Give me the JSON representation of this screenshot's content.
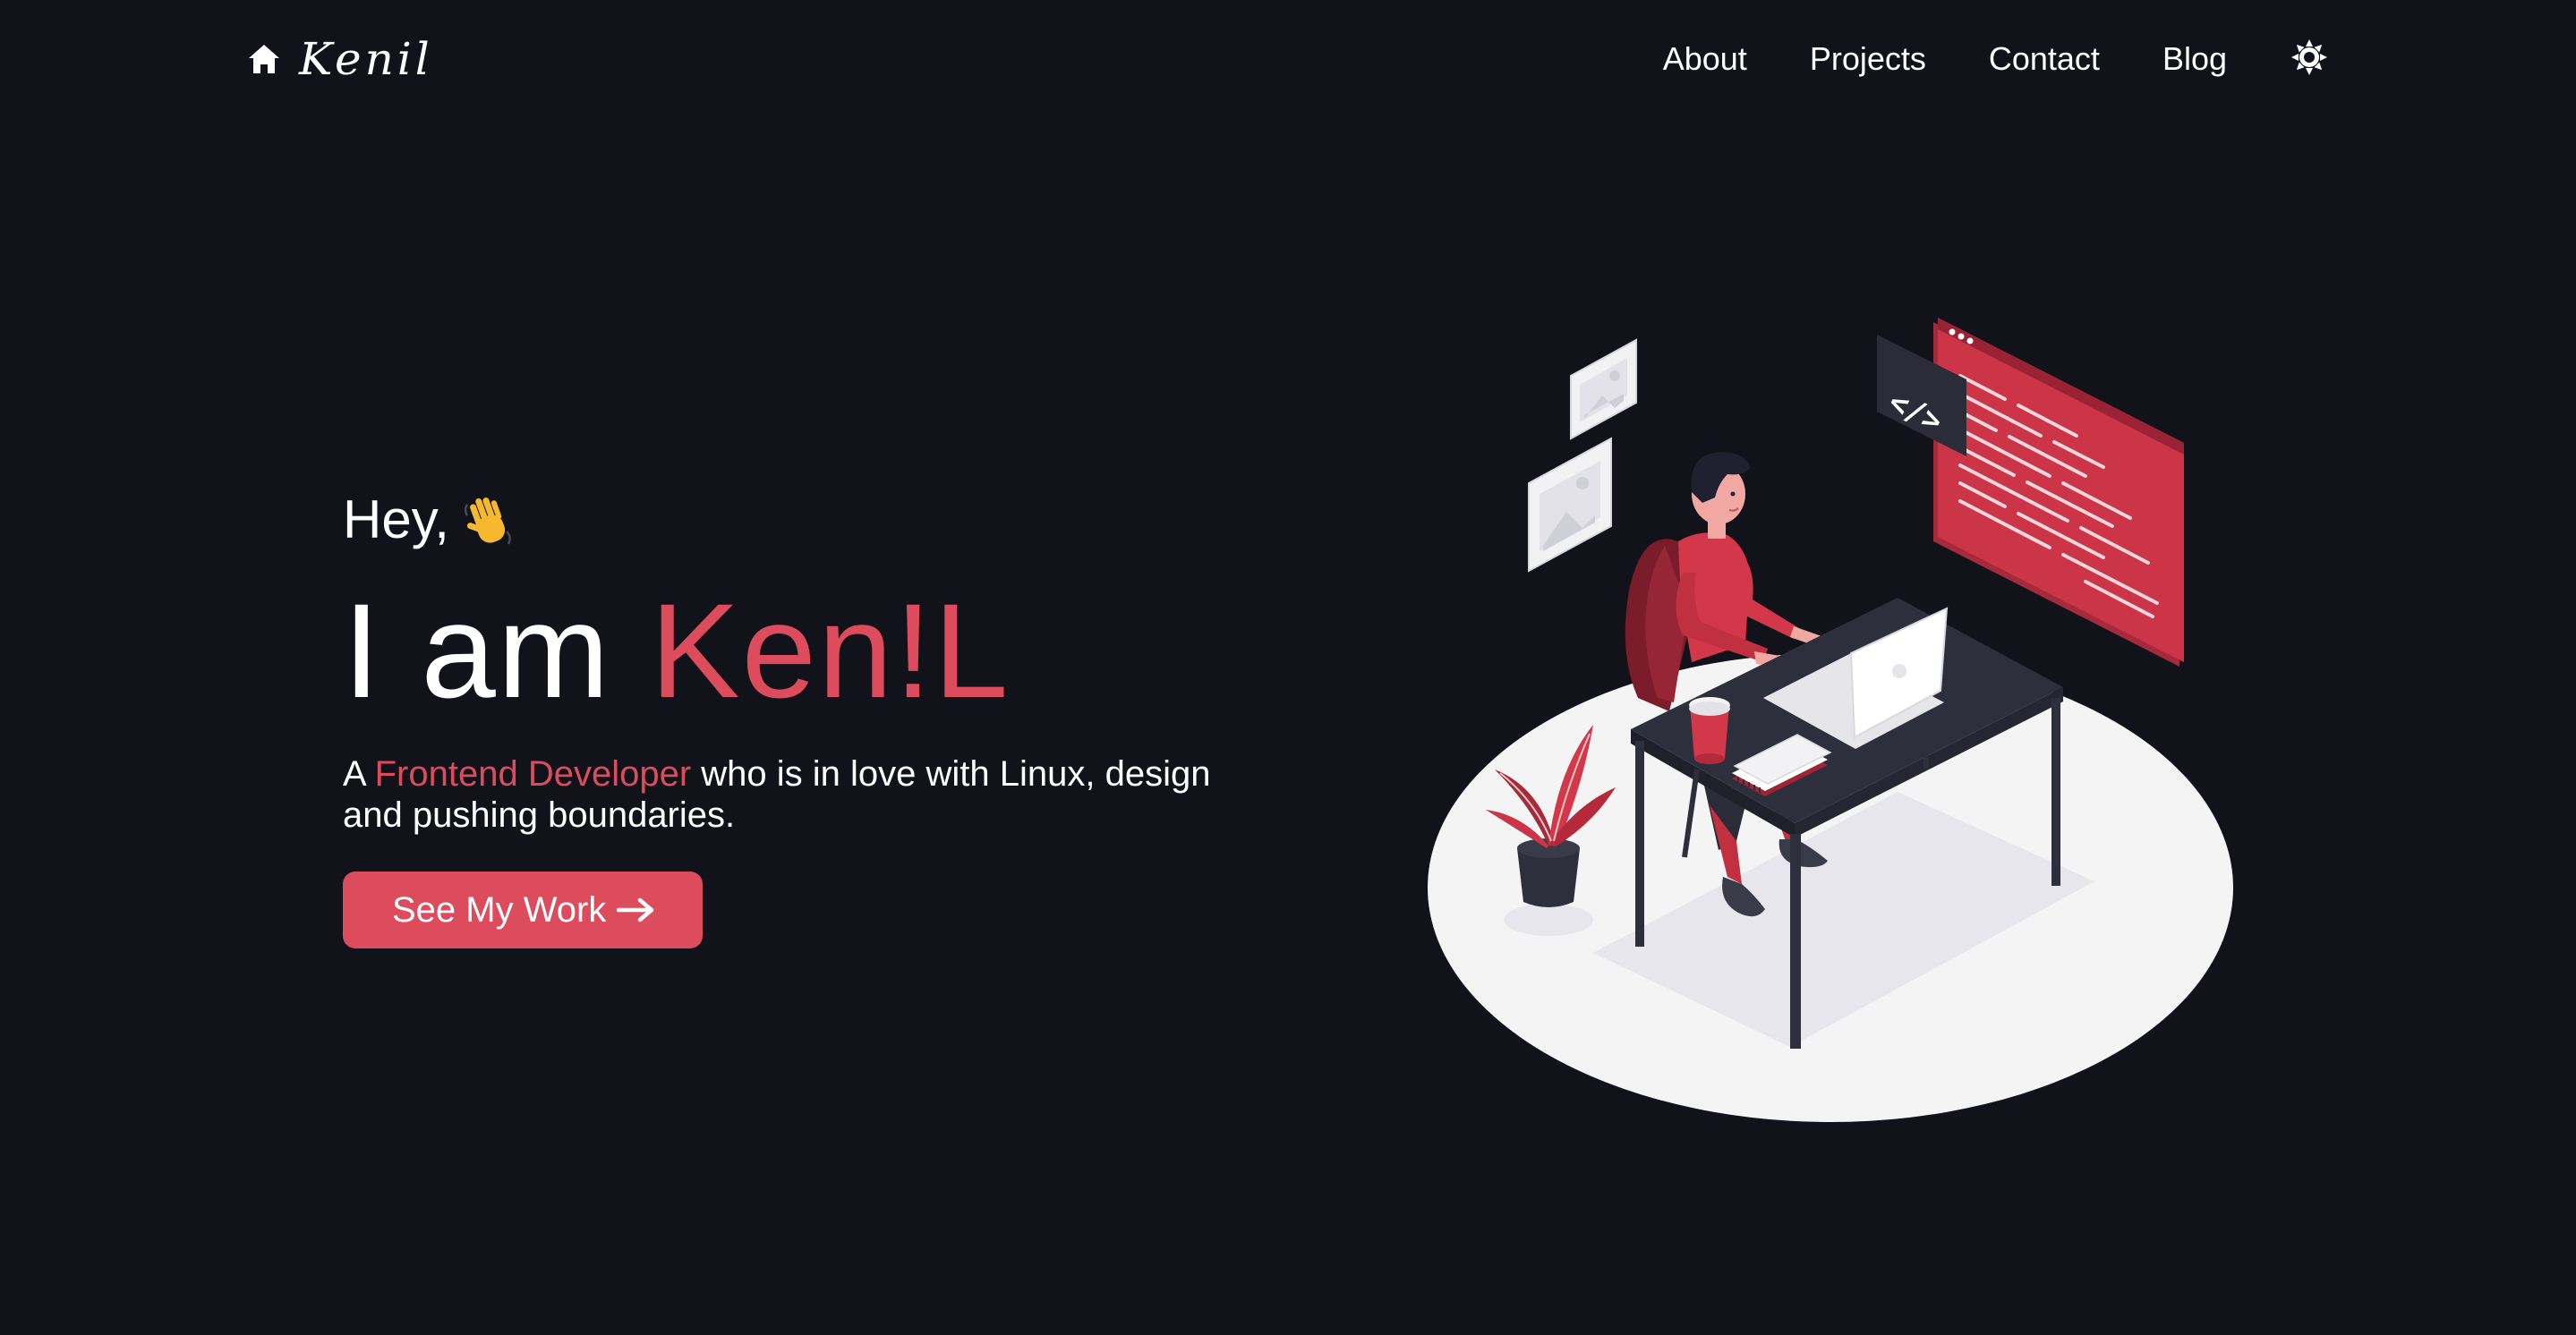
{
  "nav": {
    "brand": "Kenil",
    "home_icon": "home-icon",
    "links": [
      "About",
      "Projects",
      "Contact",
      "Blog"
    ],
    "theme_icon": "sun-icon"
  },
  "hero": {
    "greeting": "Hey,",
    "greeting_icon": "waving-hand-icon",
    "headline_prefix": "I am",
    "headline_name": "Ken!L",
    "tagline_prefix": "A",
    "tagline_role": "Frontend Developer",
    "tagline_suffix": "who is in love with Linux, design and pushing boundaries.",
    "cta_label": "See My Work",
    "cta_icon": "arrow-right-icon"
  },
  "illustration": {
    "name": "developer-at-desk-illustration",
    "code_symbol": "</>"
  },
  "colors": {
    "background": "#11121a",
    "accent": "#dc4c5c",
    "text": "#ffffff",
    "floor": "#f4f4f5",
    "desk": "#2e2f3d"
  }
}
